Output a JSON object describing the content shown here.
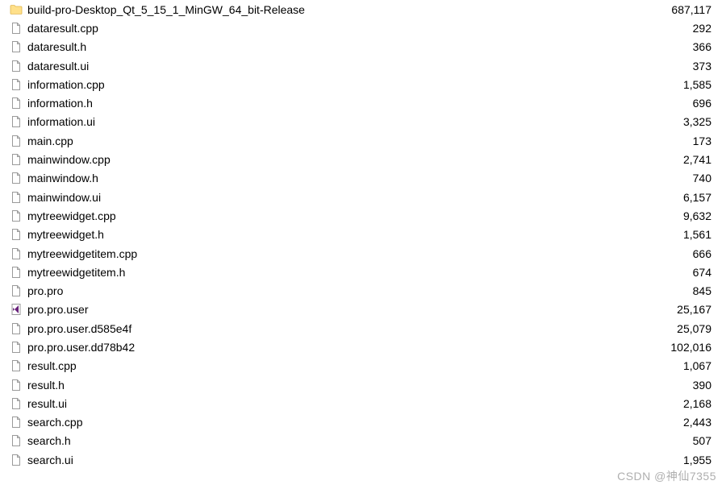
{
  "rows": [
    {
      "name": "build-pro-Desktop_Qt_5_15_1_MinGW_64_bit-Release",
      "size": "687,117",
      "type": "folder"
    },
    {
      "name": "dataresult.cpp",
      "size": "292",
      "type": "file"
    },
    {
      "name": "dataresult.h",
      "size": "366",
      "type": "file"
    },
    {
      "name": "dataresult.ui",
      "size": "373",
      "type": "file"
    },
    {
      "name": "information.cpp",
      "size": "1,585",
      "type": "file"
    },
    {
      "name": "information.h",
      "size": "696",
      "type": "file"
    },
    {
      "name": "information.ui",
      "size": "3,325",
      "type": "file"
    },
    {
      "name": "main.cpp",
      "size": "173",
      "type": "file"
    },
    {
      "name": "mainwindow.cpp",
      "size": "2,741",
      "type": "file"
    },
    {
      "name": "mainwindow.h",
      "size": "740",
      "type": "file"
    },
    {
      "name": "mainwindow.ui",
      "size": "6,157",
      "type": "file"
    },
    {
      "name": "mytreewidget.cpp",
      "size": "9,632",
      "type": "file"
    },
    {
      "name": "mytreewidget.h",
      "size": "1,561",
      "type": "file"
    },
    {
      "name": "mytreewidgetitem.cpp",
      "size": "666",
      "type": "file"
    },
    {
      "name": "mytreewidgetitem.h",
      "size": "674",
      "type": "file"
    },
    {
      "name": "pro.pro",
      "size": "845",
      "type": "file"
    },
    {
      "name": "pro.pro.user",
      "size": "25,167",
      "type": "vs"
    },
    {
      "name": "pro.pro.user.d585e4f",
      "size": "25,079",
      "type": "file"
    },
    {
      "name": "pro.pro.user.dd78b42",
      "size": "102,016",
      "type": "file"
    },
    {
      "name": "result.cpp",
      "size": "1,067",
      "type": "file"
    },
    {
      "name": "result.h",
      "size": "390",
      "type": "file"
    },
    {
      "name": "result.ui",
      "size": "2,168",
      "type": "file"
    },
    {
      "name": "search.cpp",
      "size": "2,443",
      "type": "file"
    },
    {
      "name": "search.h",
      "size": "507",
      "type": "file"
    },
    {
      "name": "search.ui",
      "size": "1,955",
      "type": "file"
    }
  ],
  "watermark": "CSDN @神仙7355"
}
